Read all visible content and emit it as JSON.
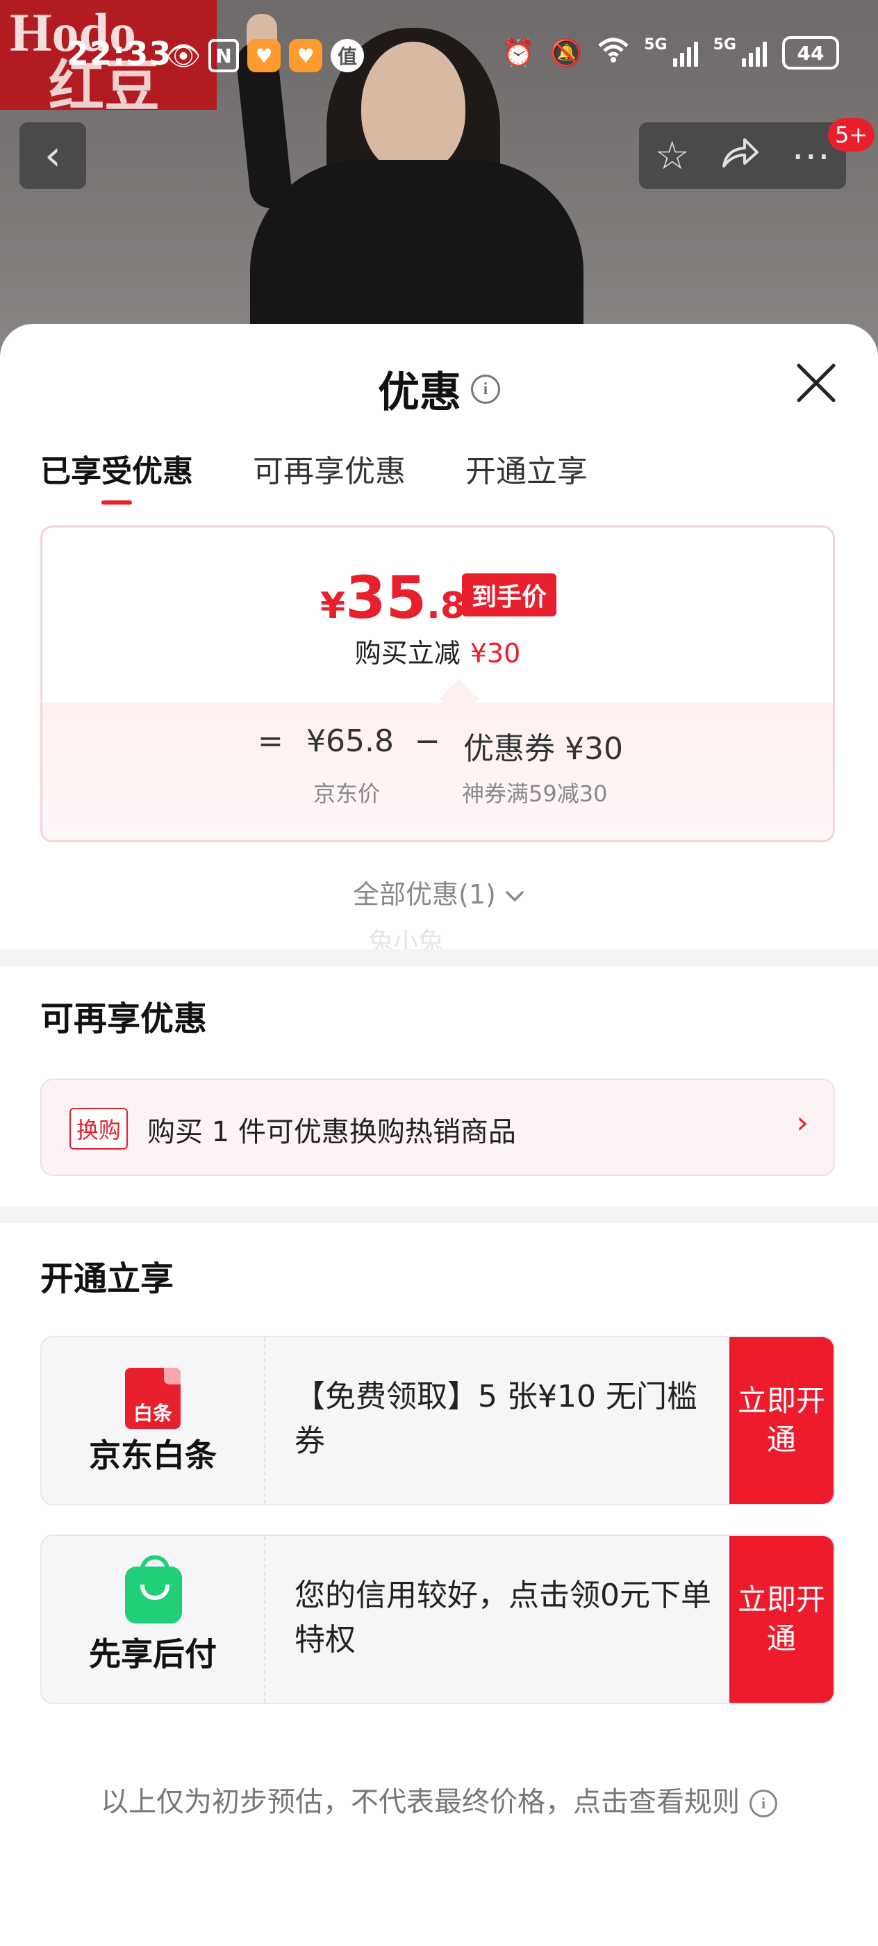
{
  "status_bar": {
    "time": "22:33",
    "net_label": "5G",
    "battery": "44",
    "icons": [
      "eye-icon",
      "nfc-icon",
      "app-heart-icon",
      "app-heart-icon",
      "zhi-icon",
      "alarm-icon",
      "mute-icon",
      "wifi-icon",
      "signal-icon",
      "battery-icon"
    ]
  },
  "header": {
    "logo_text_top": "Hodo",
    "logo_text_bottom": "红豆",
    "notification_badge": "5+"
  },
  "sheet": {
    "title": "优惠",
    "tabs": [
      {
        "label": "已享受优惠",
        "active": true
      },
      {
        "label": "可再享优惠",
        "active": false
      },
      {
        "label": "开通立享",
        "active": false
      }
    ],
    "price": {
      "currency": "¥",
      "integer": "35",
      "decimal": ".8",
      "final_tag": "到手价",
      "instant_label": "购买立减",
      "instant_value": "¥30",
      "eq_sign": "=",
      "minus_sign": "−",
      "jd_price": "¥65.8",
      "jd_price_label": "京东价",
      "coupon": "优惠券 ¥30",
      "coupon_desc": "神券满59减30"
    },
    "all_offers": "全部优惠(1)",
    "watermark": "兔小兔"
  },
  "more_offers": {
    "title": "可再享优惠",
    "tag": "换购",
    "text": "购买 1 件可优惠换购热销商品"
  },
  "open_now": {
    "title": "开通立享",
    "items": [
      {
        "icon_label": "白条",
        "name": "京东白条",
        "desc": "【免费领取】5 张¥10 无门槛券",
        "button": "立即开通"
      },
      {
        "name": "先享后付",
        "desc": "您的信用较好，点击领0元下单特权",
        "button": "立即开通"
      }
    ]
  },
  "footer": {
    "note": "以上仅为初步预估，不代表最终价格，点击查看规则"
  },
  "colors": {
    "accent_red": "#e8202d",
    "green": "#1fd078"
  }
}
